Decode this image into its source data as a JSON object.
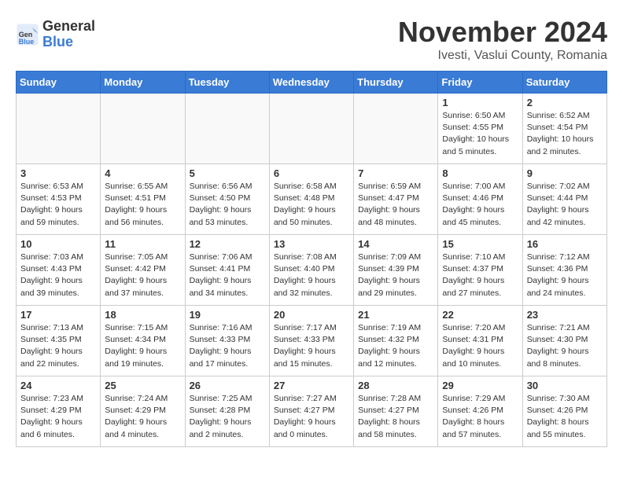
{
  "header": {
    "logo_general": "General",
    "logo_blue": "Blue",
    "month_year": "November 2024",
    "location": "Ivesti, Vaslui County, Romania"
  },
  "days_of_week": [
    "Sunday",
    "Monday",
    "Tuesday",
    "Wednesday",
    "Thursday",
    "Friday",
    "Saturday"
  ],
  "weeks": [
    [
      {
        "day": "",
        "info": ""
      },
      {
        "day": "",
        "info": ""
      },
      {
        "day": "",
        "info": ""
      },
      {
        "day": "",
        "info": ""
      },
      {
        "day": "",
        "info": ""
      },
      {
        "day": "1",
        "info": "Sunrise: 6:50 AM\nSunset: 4:55 PM\nDaylight: 10 hours\nand 5 minutes."
      },
      {
        "day": "2",
        "info": "Sunrise: 6:52 AM\nSunset: 4:54 PM\nDaylight: 10 hours\nand 2 minutes."
      }
    ],
    [
      {
        "day": "3",
        "info": "Sunrise: 6:53 AM\nSunset: 4:53 PM\nDaylight: 9 hours\nand 59 minutes."
      },
      {
        "day": "4",
        "info": "Sunrise: 6:55 AM\nSunset: 4:51 PM\nDaylight: 9 hours\nand 56 minutes."
      },
      {
        "day": "5",
        "info": "Sunrise: 6:56 AM\nSunset: 4:50 PM\nDaylight: 9 hours\nand 53 minutes."
      },
      {
        "day": "6",
        "info": "Sunrise: 6:58 AM\nSunset: 4:48 PM\nDaylight: 9 hours\nand 50 minutes."
      },
      {
        "day": "7",
        "info": "Sunrise: 6:59 AM\nSunset: 4:47 PM\nDaylight: 9 hours\nand 48 minutes."
      },
      {
        "day": "8",
        "info": "Sunrise: 7:00 AM\nSunset: 4:46 PM\nDaylight: 9 hours\nand 45 minutes."
      },
      {
        "day": "9",
        "info": "Sunrise: 7:02 AM\nSunset: 4:44 PM\nDaylight: 9 hours\nand 42 minutes."
      }
    ],
    [
      {
        "day": "10",
        "info": "Sunrise: 7:03 AM\nSunset: 4:43 PM\nDaylight: 9 hours\nand 39 minutes."
      },
      {
        "day": "11",
        "info": "Sunrise: 7:05 AM\nSunset: 4:42 PM\nDaylight: 9 hours\nand 37 minutes."
      },
      {
        "day": "12",
        "info": "Sunrise: 7:06 AM\nSunset: 4:41 PM\nDaylight: 9 hours\nand 34 minutes."
      },
      {
        "day": "13",
        "info": "Sunrise: 7:08 AM\nSunset: 4:40 PM\nDaylight: 9 hours\nand 32 minutes."
      },
      {
        "day": "14",
        "info": "Sunrise: 7:09 AM\nSunset: 4:39 PM\nDaylight: 9 hours\nand 29 minutes."
      },
      {
        "day": "15",
        "info": "Sunrise: 7:10 AM\nSunset: 4:37 PM\nDaylight: 9 hours\nand 27 minutes."
      },
      {
        "day": "16",
        "info": "Sunrise: 7:12 AM\nSunset: 4:36 PM\nDaylight: 9 hours\nand 24 minutes."
      }
    ],
    [
      {
        "day": "17",
        "info": "Sunrise: 7:13 AM\nSunset: 4:35 PM\nDaylight: 9 hours\nand 22 minutes."
      },
      {
        "day": "18",
        "info": "Sunrise: 7:15 AM\nSunset: 4:34 PM\nDaylight: 9 hours\nand 19 minutes."
      },
      {
        "day": "19",
        "info": "Sunrise: 7:16 AM\nSunset: 4:33 PM\nDaylight: 9 hours\nand 17 minutes."
      },
      {
        "day": "20",
        "info": "Sunrise: 7:17 AM\nSunset: 4:33 PM\nDaylight: 9 hours\nand 15 minutes."
      },
      {
        "day": "21",
        "info": "Sunrise: 7:19 AM\nSunset: 4:32 PM\nDaylight: 9 hours\nand 12 minutes."
      },
      {
        "day": "22",
        "info": "Sunrise: 7:20 AM\nSunset: 4:31 PM\nDaylight: 9 hours\nand 10 minutes."
      },
      {
        "day": "23",
        "info": "Sunrise: 7:21 AM\nSunset: 4:30 PM\nDaylight: 9 hours\nand 8 minutes."
      }
    ],
    [
      {
        "day": "24",
        "info": "Sunrise: 7:23 AM\nSunset: 4:29 PM\nDaylight: 9 hours\nand 6 minutes."
      },
      {
        "day": "25",
        "info": "Sunrise: 7:24 AM\nSunset: 4:29 PM\nDaylight: 9 hours\nand 4 minutes."
      },
      {
        "day": "26",
        "info": "Sunrise: 7:25 AM\nSunset: 4:28 PM\nDaylight: 9 hours\nand 2 minutes."
      },
      {
        "day": "27",
        "info": "Sunrise: 7:27 AM\nSunset: 4:27 PM\nDaylight: 9 hours\nand 0 minutes."
      },
      {
        "day": "28",
        "info": "Sunrise: 7:28 AM\nSunset: 4:27 PM\nDaylight: 8 hours\nand 58 minutes."
      },
      {
        "day": "29",
        "info": "Sunrise: 7:29 AM\nSunset: 4:26 PM\nDaylight: 8 hours\nand 57 minutes."
      },
      {
        "day": "30",
        "info": "Sunrise: 7:30 AM\nSunset: 4:26 PM\nDaylight: 8 hours\nand 55 minutes."
      }
    ]
  ]
}
